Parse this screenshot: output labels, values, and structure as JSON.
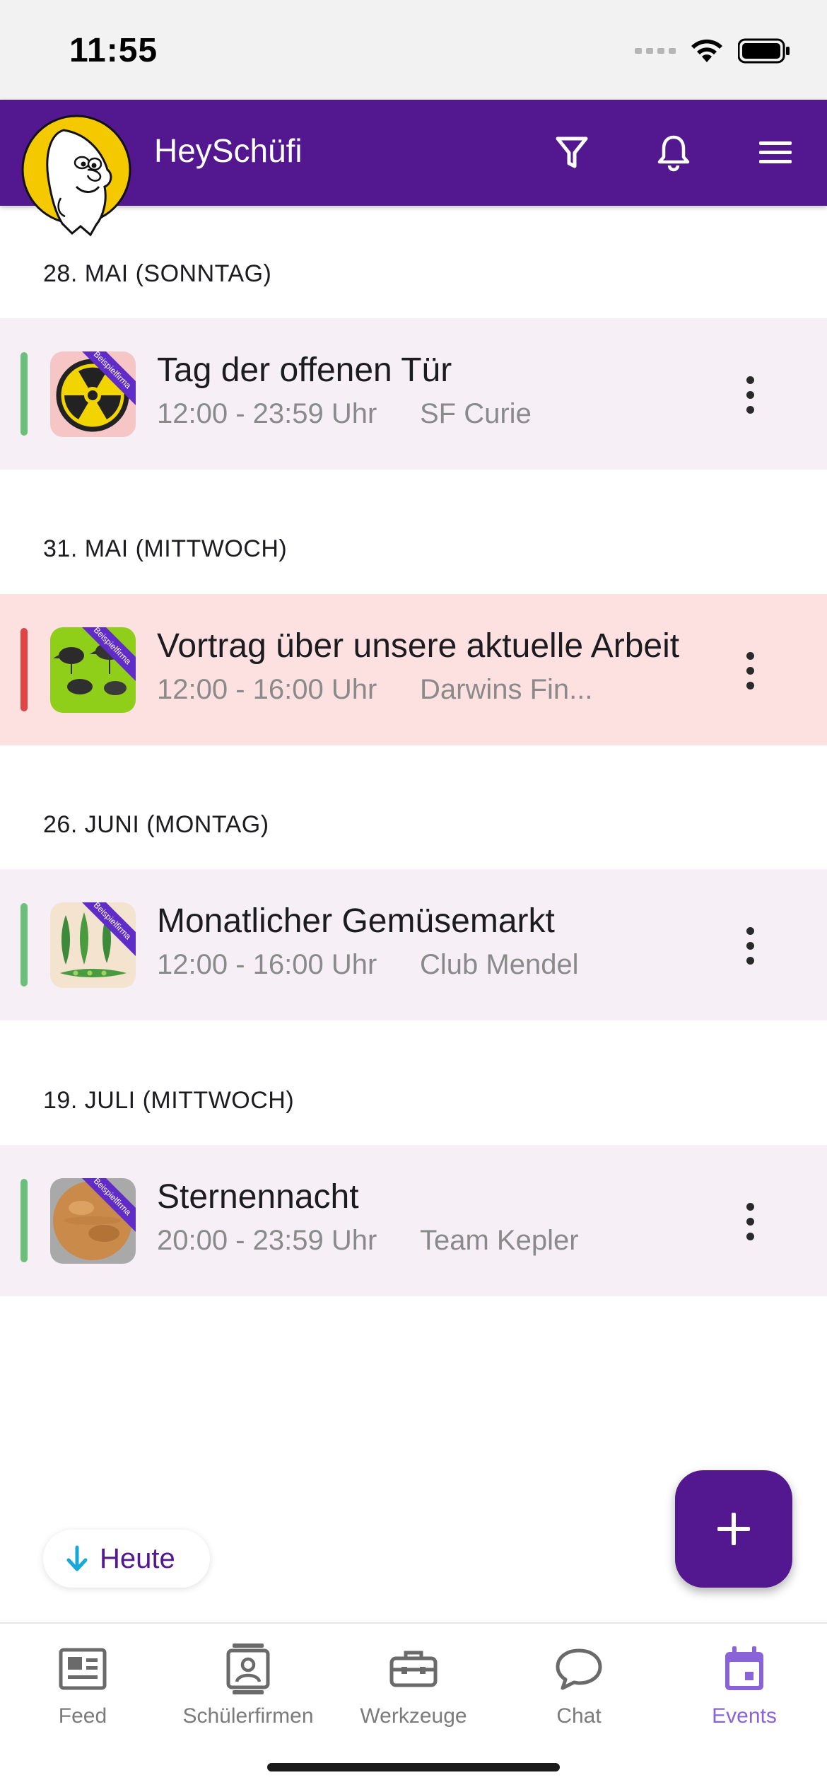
{
  "status_bar": {
    "time": "11:55"
  },
  "app_bar": {
    "title": "HeySchüfi",
    "icons": [
      "filter-icon",
      "bell-icon",
      "menu-icon"
    ]
  },
  "colors": {
    "primary": "#53178f",
    "active_nav": "#8b63d9",
    "status_green": "#6bbf7a",
    "status_red": "#e04545",
    "card_bg": "#f6f0f6",
    "card_bg_alert": "#fde1e1"
  },
  "sections": [
    {
      "date": "28. MAI (SONNTAG)",
      "event": {
        "title": "Tag der offenen Tür",
        "time": "12:00 - 23:59 Uhr",
        "org": "SF Curie",
        "status": "green",
        "badge": "Beispielfirma",
        "icon": "radiation-icon"
      }
    },
    {
      "date": "31. MAI (MITTWOCH)",
      "event": {
        "title": "Vortrag über unsere aktuelle Arbeit",
        "time": "12:00 - 16:00 Uhr",
        "org": "Darwins Fin...",
        "status": "red",
        "badge": "Beispielfirma",
        "icon": "finches-icon"
      }
    },
    {
      "date": "26. JUNI (MONTAG)",
      "event": {
        "title": "Monatlicher Gemüsemarkt",
        "time": "12:00 - 16:00 Uhr",
        "org": "Club Mendel",
        "status": "green",
        "badge": "Beispielfirma",
        "icon": "pea-pods-icon"
      }
    },
    {
      "date": "19. JULI (MITTWOCH)",
      "event": {
        "title": "Sternennacht",
        "time": "20:00 - 23:59 Uhr",
        "org": "Team Kepler",
        "status": "green",
        "badge": "Beispielfirma",
        "icon": "planet-icon"
      }
    }
  ],
  "today_button": {
    "label": "Heute"
  },
  "fab": {
    "icon": "plus-icon"
  },
  "bottom_nav": {
    "items": [
      {
        "label": "Feed",
        "icon": "feed-icon",
        "active": false
      },
      {
        "label": "Schülerfirmen",
        "icon": "company-badge-icon",
        "active": false
      },
      {
        "label": "Werkzeuge",
        "icon": "toolbox-icon",
        "active": false
      },
      {
        "label": "Chat",
        "icon": "chat-bubble-icon",
        "active": false
      },
      {
        "label": "Events",
        "icon": "calendar-icon",
        "active": true
      }
    ]
  }
}
